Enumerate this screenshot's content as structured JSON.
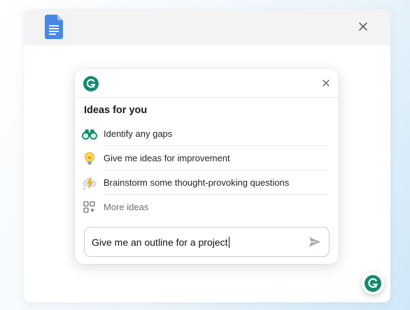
{
  "app": {
    "document_icon": "google-docs-icon",
    "window_close_icon": "close-icon"
  },
  "panel": {
    "logo_icon": "grammarly-logo-icon",
    "close_icon": "close-icon",
    "title": "Ideas for you",
    "ideas": [
      {
        "icon": "binoculars-icon",
        "label": "Identify any gaps"
      },
      {
        "icon": "lightbulb-icon",
        "label": "Give me ideas for improvement"
      },
      {
        "icon": "lightning-cloud-icon",
        "label": "Brainstorm some thought-provoking questions"
      },
      {
        "icon": "grid-sparkle-icon",
        "label": "More ideas"
      }
    ],
    "prompt": {
      "value": "Give me an outline for a project",
      "send_icon": "send-icon"
    }
  },
  "floating_button": {
    "icon": "grammarly-logo-icon"
  },
  "colors": {
    "grammarly_green": "#15896c",
    "docs_blue": "#4a86e8",
    "muted_text": "#6b6e75"
  }
}
